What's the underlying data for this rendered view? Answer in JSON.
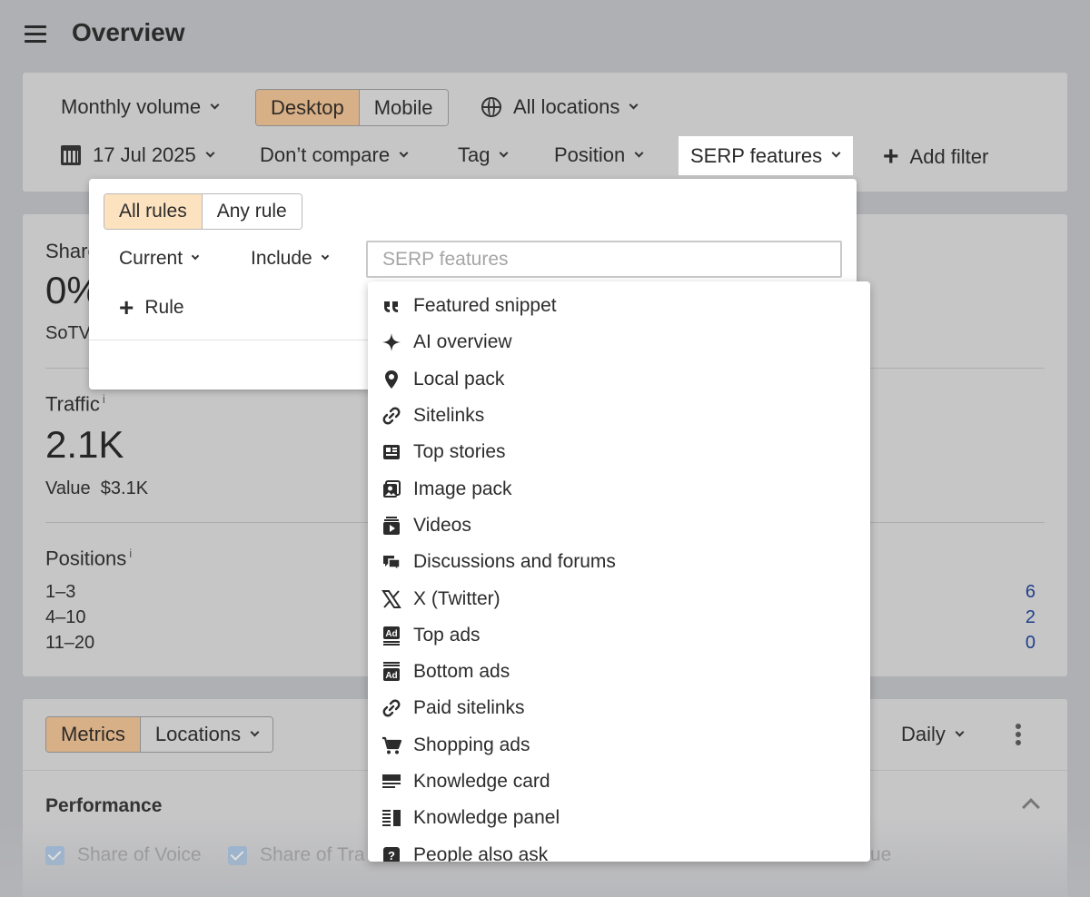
{
  "header": {
    "title": "Overview"
  },
  "filters": {
    "volume_label": "Monthly volume",
    "device_options": [
      "Desktop",
      "Mobile"
    ],
    "device_selected": "Desktop",
    "locations_label": "All locations",
    "date_label": "17 Jul 2025",
    "compare_label": "Don’t compare",
    "tag_label": "Tag",
    "position_label": "Position",
    "serp_label": "SERP features",
    "add_filter_label": "Add filter"
  },
  "popup": {
    "rule_modes": [
      "All rules",
      "Any rule"
    ],
    "rule_mode_selected": "All rules",
    "scope_label": "Current",
    "include_label": "Include",
    "serp_input_placeholder": "SERP features",
    "add_rule_label": "Rule"
  },
  "serp_options": [
    {
      "label": "Featured snippet",
      "icon": "quote-icon"
    },
    {
      "label": "AI overview",
      "icon": "sparkle-icon"
    },
    {
      "label": "Local pack",
      "icon": "map-pin-icon"
    },
    {
      "label": "Sitelinks",
      "icon": "link-icon"
    },
    {
      "label": "Top stories",
      "icon": "newspaper-icon"
    },
    {
      "label": "Image pack",
      "icon": "image-icon"
    },
    {
      "label": "Videos",
      "icon": "video-icon"
    },
    {
      "label": "Discussions and forums",
      "icon": "chat-bubbles-icon"
    },
    {
      "label": "X (Twitter)",
      "icon": "x-twitter-icon"
    },
    {
      "label": "Top ads",
      "icon": "ad-top-icon"
    },
    {
      "label": "Bottom ads",
      "icon": "ad-bottom-icon"
    },
    {
      "label": "Paid sitelinks",
      "icon": "link-icon"
    },
    {
      "label": "Shopping ads",
      "icon": "cart-icon"
    },
    {
      "label": "Knowledge card",
      "icon": "knowledge-card-icon"
    },
    {
      "label": "Knowledge panel",
      "icon": "knowledge-panel-icon"
    },
    {
      "label": "People also ask",
      "icon": "question-icon"
    }
  ],
  "stats": {
    "share_label": "Share",
    "share_value": "0%",
    "sotv_label": "SoTV",
    "traffic_label": "Traffic",
    "traffic_info": "i",
    "traffic_value": "2.1K",
    "value_label": "Value",
    "value_amount": "$3.1K",
    "positions_label": "Positions",
    "positions_info": "i",
    "positions": [
      {
        "range": "1–3",
        "count": "6"
      },
      {
        "range": "4–10",
        "count": "2"
      },
      {
        "range": "11–20",
        "count": "0"
      }
    ]
  },
  "metrics": {
    "tabs": [
      "Metrics",
      "Locations"
    ],
    "tab_selected": "Metrics",
    "interval_label": "Daily",
    "performance_title": "Performance",
    "checkboxes": [
      "Share of Voice",
      "Share of Tra",
      "ue"
    ]
  },
  "colors": {
    "accent_selected": "#d8b088",
    "popup_selected": "#fde2c0",
    "link_blue": "#1f3f8a",
    "checkbox_blue": "#8fb3d9"
  }
}
